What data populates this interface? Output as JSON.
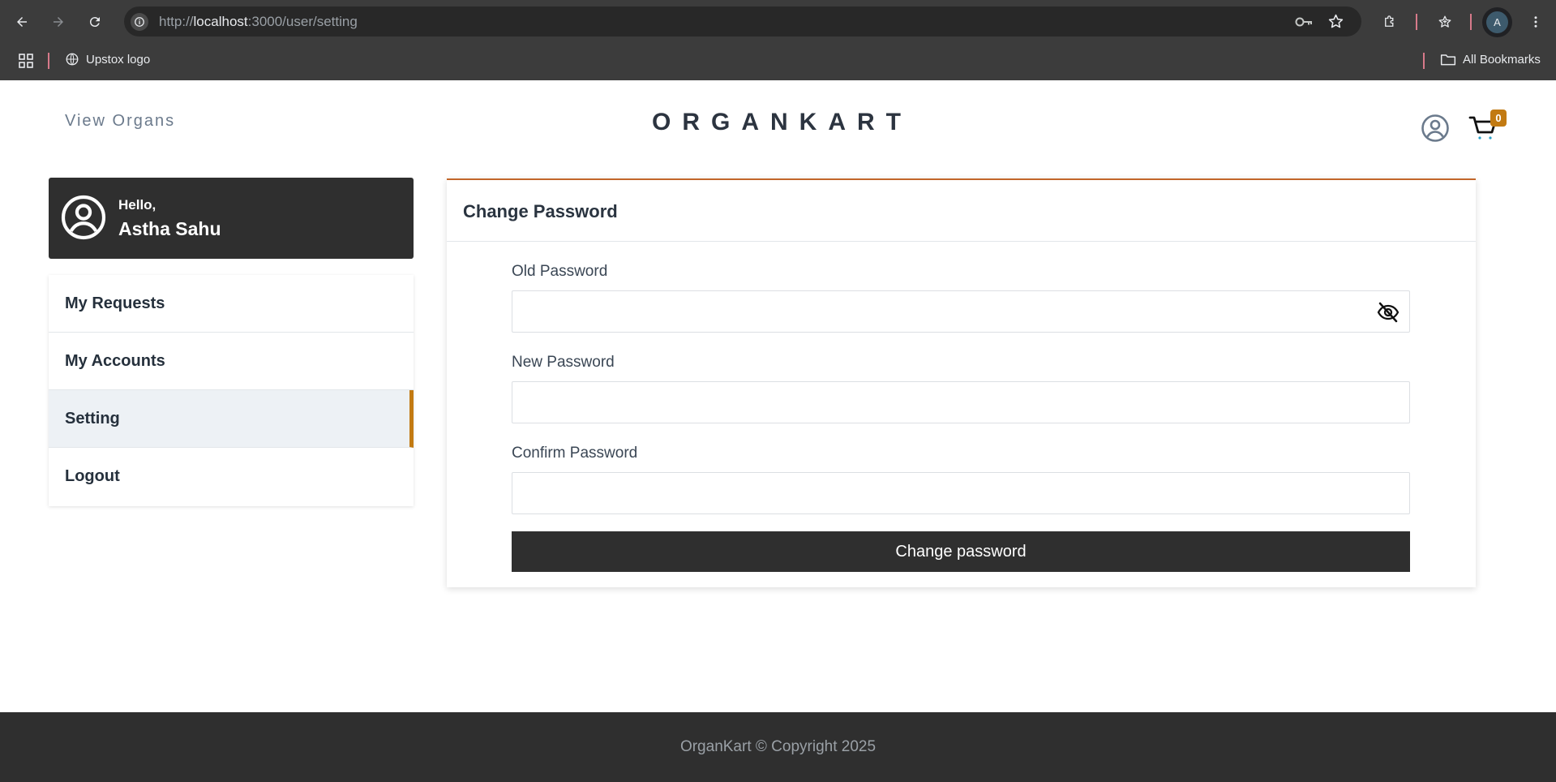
{
  "browser": {
    "url_scheme": "http://",
    "url_host": "localhost",
    "url_path": ":3000/user/setting",
    "profile_initial": "A",
    "icons": [
      "back-arrow-icon",
      "forward-arrow-icon",
      "reload-icon",
      "info-icon",
      "password-key-icon",
      "star-icon",
      "extensions-icon",
      "bookmark-star-icon",
      "menu-dots-icon"
    ]
  },
  "bookmarks": {
    "items": [
      {
        "label": "Upstox logo",
        "icon": "globe-icon"
      }
    ],
    "all_bookmarks_label": "All Bookmarks"
  },
  "header": {
    "nav_link": "View Organs",
    "logo": "ORGANKART",
    "cart_count": "0"
  },
  "sidebar": {
    "greeting": "Hello,",
    "user_name": "Astha Sahu",
    "items": [
      {
        "label": "My Requests"
      },
      {
        "label": "My Accounts"
      },
      {
        "label": "Setting"
      },
      {
        "label": "Logout"
      }
    ],
    "active_item": "Setting"
  },
  "main": {
    "title": "Change Password",
    "fields": [
      {
        "label": "Old Password",
        "value": ""
      },
      {
        "label": "New Password",
        "value": ""
      },
      {
        "label": "Confirm Password",
        "value": ""
      }
    ],
    "submit_label": "Change password"
  },
  "footer": {
    "text": "OrganKart © Copyright 2025"
  },
  "colors": {
    "accent": "#c27a12",
    "card_top_border": "#c2662a",
    "dark": "#2f2f2f"
  }
}
